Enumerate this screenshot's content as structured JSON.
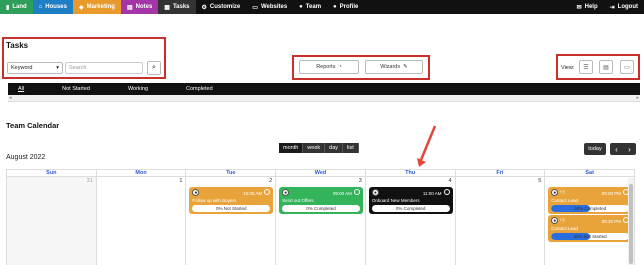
{
  "nav": {
    "items": [
      {
        "icon": "chart-icon",
        "label": "Land",
        "bg": "#2e9e5b"
      },
      {
        "icon": "home-icon",
        "label": "Houses",
        "bg": "#1f7fc4"
      },
      {
        "icon": "tag-icon",
        "label": "Marketing",
        "bg": "#e89a2c"
      },
      {
        "icon": "note-icon",
        "label": "Notes",
        "bg": "#a335a6"
      },
      {
        "icon": "calendar-icon",
        "label": "Tasks",
        "bg": "#333333"
      },
      {
        "icon": "gear-icon",
        "label": "Customize",
        "bg": "#111111"
      },
      {
        "icon": "monitor-icon",
        "label": "Websites",
        "bg": "#111111"
      },
      {
        "icon": "user-icon",
        "label": "Team",
        "bg": "#111111"
      },
      {
        "icon": "user-icon",
        "label": "Profile",
        "bg": "#111111"
      }
    ],
    "right": [
      {
        "icon": "chat-icon",
        "label": "Help"
      },
      {
        "icon": "logout-icon",
        "label": "Logout"
      }
    ]
  },
  "tasks": {
    "title": "Tasks",
    "filter_value": "Keyword",
    "search_placeholder": "Search",
    "reports_label": "Reports",
    "wizards_label": "Wizards",
    "view_label": "View:",
    "tabs": [
      "All",
      "Not Started",
      "Working",
      "Completed"
    ]
  },
  "calendar": {
    "title": "Team Calendar",
    "month": "August 2022",
    "views": [
      "month",
      "week",
      "day",
      "list"
    ],
    "today_label": "today",
    "days": [
      "Sun",
      "Mon",
      "Tue",
      "Wed",
      "Thu",
      "Fri",
      "Sat"
    ],
    "dates": [
      "31",
      "1",
      "2",
      "3",
      "4",
      "5",
      "6"
    ],
    "events": [
      {
        "day": 2,
        "time": "10:00 AM",
        "name": "Follow up with Buyers",
        "status": "0% Not Started",
        "progress": 0,
        "color": "#e8a43a"
      },
      {
        "day": 3,
        "time": "09:00 AM",
        "name": "Send out Offers",
        "status": "0% Completed",
        "progress": 0,
        "color": "#34b45a"
      },
      {
        "day": 4,
        "time": "11:00 AM",
        "name": "Onboard New Members",
        "status": "0% Completed",
        "progress": 0,
        "color": "#111111"
      },
      {
        "day": 6,
        "time": "09:00 PM",
        "name": "Contact Lead",
        "status": "50% Completed",
        "progress": 50,
        "color": "#e8a43a",
        "avatar_count": "+3"
      },
      {
        "day": 6,
        "time": "09:30 PM",
        "name": "Contact Lead",
        "status": "50% Not Started",
        "progress": 50,
        "color": "#e8a43a",
        "avatar_count": "+3"
      }
    ]
  },
  "colors": {
    "annotation_red": "#c9302c",
    "today_blue": "#2a5bd7"
  }
}
